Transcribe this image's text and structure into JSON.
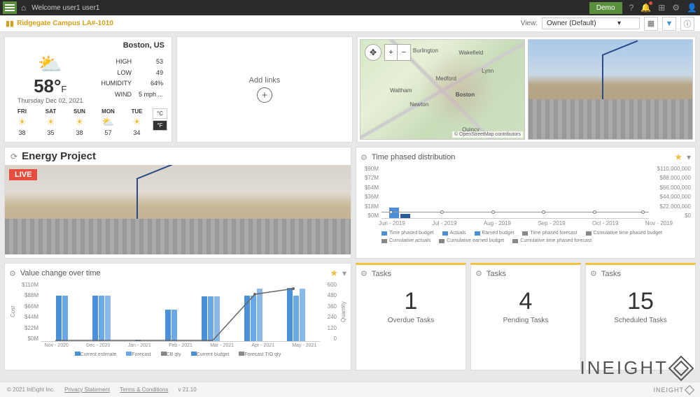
{
  "topbar": {
    "welcome": "Welcome user1 user1",
    "demo": "Demo"
  },
  "subbar": {
    "project": "Ridgegate Campus LA#-1010",
    "view_label": "View:",
    "view_value": "Owner (Default)"
  },
  "weather": {
    "location": "Boston, US",
    "temp": "58°",
    "unit": "F",
    "date": "Thursday Dec 02, 2021",
    "stats": {
      "high_l": "HIGH",
      "high_v": "53",
      "low_l": "LOW",
      "low_v": "49",
      "hum_l": "HUMIDITY",
      "hum_v": "64%",
      "wind_l": "WIND",
      "wind_v": "5 mph ..."
    },
    "forecast": [
      {
        "d": "FRI",
        "t": "38"
      },
      {
        "d": "SAT",
        "t": "35"
      },
      {
        "d": "SUN",
        "t": "38"
      },
      {
        "d": "MON",
        "t": "57"
      },
      {
        "d": "TUE",
        "t": "34"
      }
    ],
    "c": "°C",
    "f": "°F"
  },
  "addlinks": {
    "label": "Add links"
  },
  "map": {
    "cities": {
      "boston": "Boston",
      "newton": "Newton",
      "quincy": "Quincy",
      "lynn": "Lynn",
      "waltham": "Waltham",
      "medford": "Medford",
      "burlington": "Burlington",
      "wakefield": "Wakefield"
    },
    "attrib": "© OpenStreetMap contributors"
  },
  "energy": {
    "title": "Energy Project",
    "live": "LIVE"
  },
  "timephased": {
    "title": "Time phased distribution",
    "y1": [
      "$90M",
      "$72M",
      "$54M",
      "$36M",
      "$18M",
      "$0M"
    ],
    "y2": [
      "$110,000,000",
      "$88,000,000",
      "$66,000,000",
      "$44,000,000",
      "$22,000,000",
      "$0"
    ],
    "x": [
      "Jun - 2019",
      "Jul - 2019",
      "Aug - 2019",
      "Sep - 2019",
      "Oct - 2019",
      "Nov - 2019"
    ],
    "legend": [
      "Time phased budget",
      "Time phased forecast",
      "Cumulative earned budget",
      "Actuals",
      "Cumulative time phased budget",
      "Cumulative time phased forecast",
      "Earned budget",
      "Cumulative actuals"
    ]
  },
  "valuechange": {
    "title": "Value change over time",
    "ylabel": "Cost",
    "ylabel2": "Quantity",
    "y1": [
      "$110M",
      "$88M",
      "$66M",
      "$44M",
      "$22M",
      "$0M"
    ],
    "y2": [
      "600",
      "480",
      "360",
      "240",
      "120",
      "0"
    ],
    "x": [
      "Nov - 2020",
      "Dec - 2020",
      "Jan - 2021",
      "Feb - 2021",
      "Mar - 2021",
      "Apr - 2021",
      "May - 2021"
    ],
    "legend": [
      "Current estimate",
      "Current budget",
      "Forecast",
      "Forecast T/O qty",
      "CB qty"
    ]
  },
  "tasks": [
    {
      "title": "Tasks",
      "num": "1",
      "label": "Overdue Tasks"
    },
    {
      "title": "Tasks",
      "num": "4",
      "label": "Pending Tasks"
    },
    {
      "title": "Tasks",
      "num": "15",
      "label": "Scheduled Tasks"
    }
  ],
  "footer": {
    "copy": "© 2021 InEight Inc.",
    "privacy": "Privacy Statement",
    "terms": "Terms & Conditions",
    "ver": "v 21.10",
    "brand": "INEIGHT"
  },
  "chart_data": [
    {
      "type": "bar",
      "title": "Time phased distribution",
      "x": [
        "Jun - 2019",
        "Jul - 2019",
        "Aug - 2019",
        "Sep - 2019",
        "Oct - 2019",
        "Nov - 2019"
      ],
      "series": [
        {
          "name": "Time phased budget",
          "values": [
            18,
            2,
            2,
            2,
            2,
            2
          ],
          "unit": "$M"
        },
        {
          "name": "Actuals",
          "values": [
            6,
            0,
            0,
            0,
            0,
            0
          ],
          "unit": "$M"
        }
      ],
      "y_left": {
        "label": "",
        "range": [
          0,
          90
        ],
        "unit": "$M"
      },
      "y_right": {
        "label": "",
        "range": [
          0,
          110000000
        ],
        "unit": "$"
      }
    },
    {
      "type": "bar",
      "title": "Value change over time",
      "x": [
        "Nov - 2020",
        "Dec - 2020",
        "Jan - 2021",
        "Feb - 2021",
        "Mar - 2021",
        "Apr - 2021",
        "May - 2021"
      ],
      "series": [
        {
          "name": "Current estimate",
          "values": [
            85,
            85,
            0,
            58,
            82,
            85,
            98
          ],
          "unit": "$M"
        },
        {
          "name": "Current budget",
          "values": [
            85,
            85,
            0,
            58,
            82,
            85,
            85
          ],
          "unit": "$M"
        },
        {
          "name": "Forecast",
          "values": [
            0,
            85,
            0,
            0,
            82,
            97,
            97
          ],
          "unit": "$M"
        },
        {
          "name": "CB qty (line, right axis)",
          "values": [
            0,
            0,
            0,
            0,
            0,
            470,
            520
          ],
          "unit": "qty"
        }
      ],
      "y_left": {
        "label": "Cost",
        "range": [
          0,
          110
        ],
        "unit": "$M"
      },
      "y_right": {
        "label": "Quantity",
        "range": [
          0,
          600
        ]
      }
    }
  ]
}
